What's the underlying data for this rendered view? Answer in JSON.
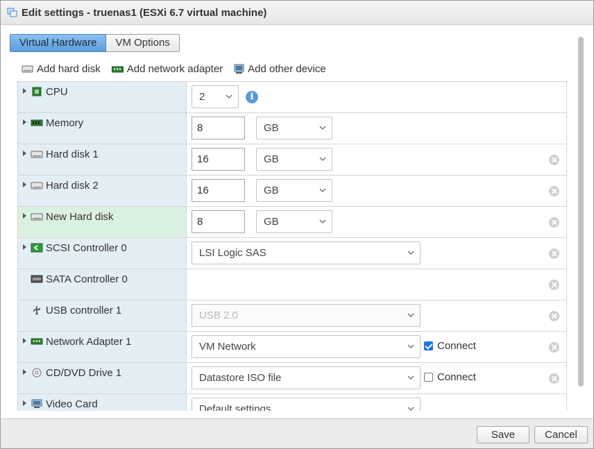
{
  "title": "Edit settings - truenas1 (ESXi 6.7 virtual machine)",
  "tabs": [
    {
      "label": "Virtual Hardware"
    },
    {
      "label": "VM Options"
    }
  ],
  "toolbar": {
    "add_hard_disk": "Add hard disk",
    "add_network_adapter": "Add network adapter",
    "add_other_device": "Add other device"
  },
  "devices": {
    "cpu": {
      "label": "CPU",
      "value": "2"
    },
    "memory": {
      "label": "Memory",
      "value": "8",
      "unit": "GB"
    },
    "hd1": {
      "label": "Hard disk 1",
      "value": "16",
      "unit": "GB"
    },
    "hd2": {
      "label": "Hard disk 2",
      "value": "16",
      "unit": "GB"
    },
    "newhd": {
      "label": "New Hard disk",
      "value": "8",
      "unit": "GB"
    },
    "scsi": {
      "label": "SCSI Controller 0",
      "value": "LSI Logic SAS"
    },
    "sata": {
      "label": "SATA Controller 0"
    },
    "usb": {
      "label": "USB controller 1",
      "value": "USB 2.0"
    },
    "net": {
      "label": "Network Adapter 1",
      "value": "VM Network",
      "connect_label": "Connect",
      "connected": true
    },
    "cd": {
      "label": "CD/DVD Drive 1",
      "value": "Datastore ISO file",
      "connect_label": "Connect",
      "connected": false
    },
    "video": {
      "label": "Video Card",
      "value": "Default settings"
    }
  },
  "buttons": {
    "save": "Save",
    "cancel": "Cancel"
  },
  "icons": {
    "info": "i"
  },
  "colors": {
    "tab_active": "#5b9bdb",
    "row_label_bg": "#e4eef5",
    "row_new_bg": "#daf0e0",
    "checkbox_checked": "#1a73e8"
  }
}
